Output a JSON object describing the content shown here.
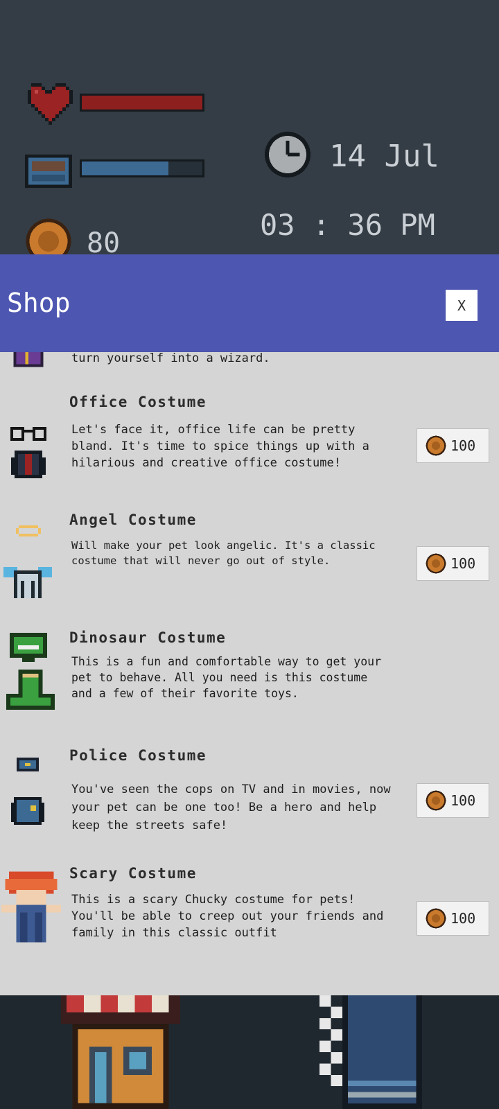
{
  "hud": {
    "coins": "80",
    "date": "14 Jul",
    "time": "03 : 36 PM",
    "health_level": 1.0,
    "hunger_level": 0.72,
    "icons": [
      "heart-icon",
      "food-bowl-icon",
      "coin-icon",
      "clock-icon"
    ]
  },
  "shop": {
    "title": "Shop",
    "close_label": "X",
    "partial_item": {
      "desc": "turn yourself into a wizard."
    },
    "items": [
      {
        "title": "Office Costume",
        "desc": "Let's face it, office life can be pretty bland. It's time to spice things up with a hilarious and creative office costume!",
        "price": "100"
      },
      {
        "title": "Angel Costume",
        "desc": "Will make your pet look angelic. It's a classic costume that will never go out of style.",
        "price": "100"
      },
      {
        "title": "Dinosaur Costume",
        "desc": "This is a fun and comfortable way to get your pet to behave. All you need is this costume and a few of their favorite toys."
      },
      {
        "title": "Police Costume",
        "desc": "You've seen the cops on TV and in movies, now your pet can be one too! Be a hero and help keep the streets safe!",
        "price": "100"
      },
      {
        "title": "Scary Costume",
        "desc": "This is a scary Chucky costume for pets! You'll be able to creep out your friends and family in this classic outfit",
        "price": "100"
      }
    ]
  },
  "bottom_nav": {
    "icons": [
      "shop-icon",
      "closet-icon"
    ]
  },
  "colors": {
    "background": "#343d45",
    "header": "#4d56b0",
    "list": "#d5d5d5",
    "health": "#8e1f1f",
    "hunger": "#3d6a93"
  }
}
